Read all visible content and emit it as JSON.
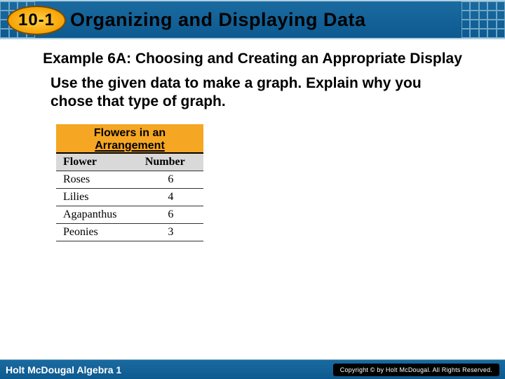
{
  "header": {
    "chapter": "10-1",
    "title": "Organizing and Displaying Data"
  },
  "example": {
    "heading": "Example 6A: Choosing and Creating an Appropriate Display",
    "instruction": "Use the given data to make a graph. Explain why you chose that type of graph."
  },
  "chart_data": {
    "type": "table",
    "title_line1": "Flowers in an",
    "title_line2": "Arrangement",
    "columns": [
      "Flower",
      "Number"
    ],
    "rows": [
      {
        "flower": "Roses",
        "number": 6
      },
      {
        "flower": "Lilies",
        "number": 4
      },
      {
        "flower": "Agapanthus",
        "number": 6
      },
      {
        "flower": "Peonies",
        "number": 3
      }
    ]
  },
  "footer": {
    "left": "Holt McDougal Algebra 1",
    "right": "Copyright © by Holt McDougal. All Rights Reserved."
  }
}
